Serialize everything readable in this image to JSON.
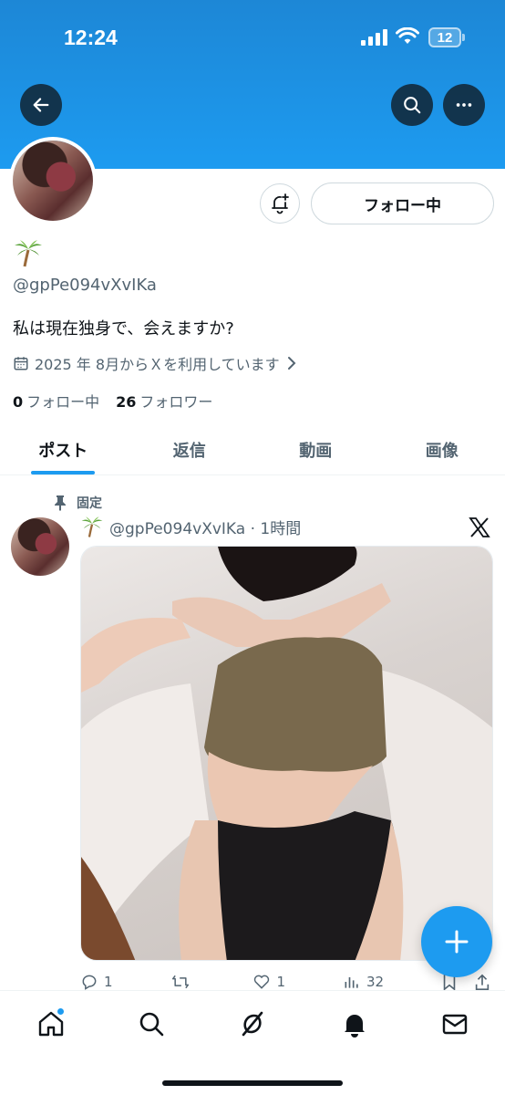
{
  "status_bar": {
    "time": "12:24",
    "battery": "12"
  },
  "profile": {
    "display_name": "🌴",
    "handle": "@gpPe094vXvIKa",
    "bio": "私は現在独身で、会えますか?",
    "joined": "2025 年 8月からＸを利用しています",
    "following_count": "0",
    "following_label": "フォロー中",
    "followers_count": "26",
    "followers_label": "フォロワー",
    "follow_button_label": "フォロー中"
  },
  "tabs": [
    {
      "label": "ポスト",
      "active": true
    },
    {
      "label": "返信",
      "active": false
    },
    {
      "label": "動画",
      "active": false
    },
    {
      "label": "画像",
      "active": false
    }
  ],
  "post": {
    "pinned_label": "固定",
    "author_name": "🌴",
    "handle_time": "@gpPe094vXvIKa · 1時間",
    "replies": "1",
    "reposts": "",
    "likes": "1",
    "views": "32"
  },
  "colors": {
    "accent": "#1d9bf0",
    "text": "#0f1419",
    "muted": "#536471"
  },
  "icons": [
    "back-arrow-icon",
    "search-icon",
    "more-icon",
    "bell-plus-icon",
    "calendar-icon",
    "chevron-right-icon",
    "pin-icon",
    "x-logo-icon",
    "reply-icon",
    "repost-icon",
    "like-icon",
    "views-icon",
    "bookmark-icon",
    "share-icon",
    "plus-icon",
    "home-icon",
    "explore-icon",
    "grok-icon",
    "notifications-icon",
    "messages-icon"
  ]
}
